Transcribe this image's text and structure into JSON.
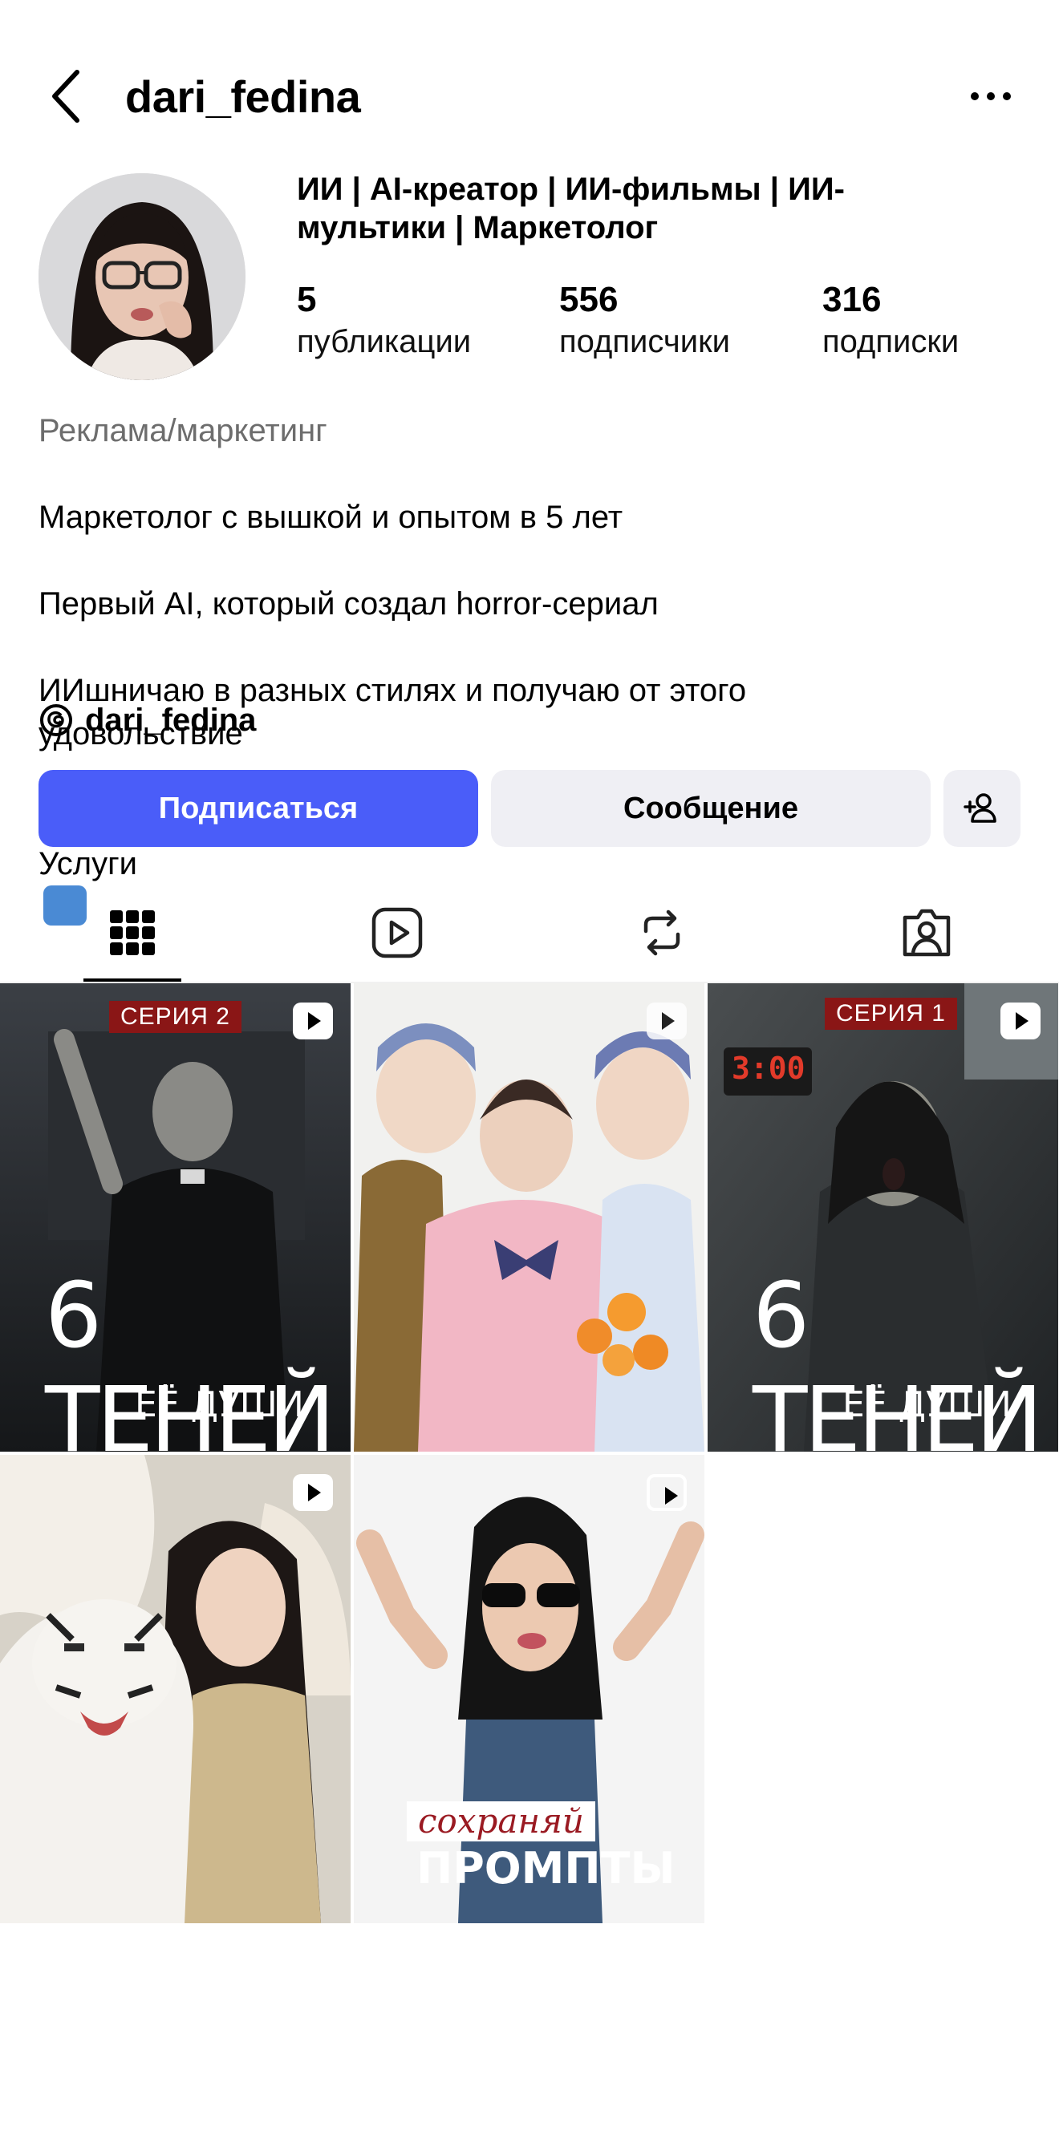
{
  "header": {
    "username": "dari_fedina"
  },
  "profile": {
    "title": "ИИ | AI-креатор | ИИ-фильмы | ИИ-мультики | Маркетолог",
    "stats": [
      {
        "value": "5",
        "label": "публикации"
      },
      {
        "value": "556",
        "label": "подписчики"
      },
      {
        "value": "316",
        "label": "подписки"
      }
    ],
    "category": "Реклама/маркетинг",
    "bio": [
      "Маркетолог с вышкой и опытом в 5 лет",
      "Первый AI, который создал horror-сериал",
      "ИИшничаю в разных стилях и получаю от этого удовольствие",
      "Услуги"
    ],
    "threads_handle": "dari_fedina"
  },
  "actions": {
    "follow_label": "Подписаться",
    "message_label": "Сообщение"
  },
  "tabs": [
    "grid-icon",
    "reels-icon",
    "reposts-icon",
    "tagged-icon"
  ],
  "posts": [
    {
      "badge": "СЕРИЯ 2",
      "title_line1": "6 ТЕНЕЙ",
      "title_line2": "ЕЁ ДУШИ",
      "type": "video"
    },
    {
      "type": "video"
    },
    {
      "badge": "СЕРИЯ 1",
      "clock": "3:00",
      "title_line1": "6 ТЕНЕЙ",
      "title_line2": "ЕЁ ДУШИ",
      "type": "video"
    },
    {
      "type": "video"
    },
    {
      "caption_top": "сохраняй",
      "caption_bottom": "ПРОМПТЫ",
      "type": "carousel"
    }
  ],
  "colors": {
    "follow_button": "#4a5df9",
    "secondary_button": "#efeff4",
    "badge": "#8a1616"
  }
}
